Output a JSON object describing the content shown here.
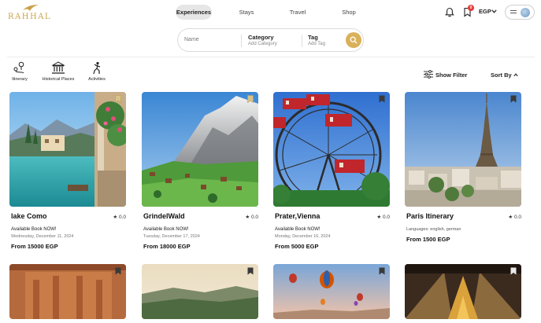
{
  "brand": {
    "name": "RAHHAL",
    "accent": "#c9a24a",
    "search_button": "#d9b15a"
  },
  "nav": {
    "experiences": "Experiences",
    "stays": "Stays",
    "travel": "Travel",
    "shop": "Shop"
  },
  "header": {
    "notification_count": "0",
    "currency": "EGP"
  },
  "search": {
    "name_placeholder": "Name",
    "category_label": "Category",
    "category_placeholder": "Add Category",
    "tag_label": "Tag",
    "tag_placeholder": "Add Tag"
  },
  "categories": [
    {
      "label": "Itinerary",
      "icon": "pin-route-icon"
    },
    {
      "label": "Historical Places",
      "icon": "museum-icon"
    },
    {
      "label": "Activities",
      "icon": "person-activity-icon"
    }
  ],
  "toolbar": {
    "filter_label": "Show Filter",
    "sort_label": "Sort By"
  },
  "cards": [
    {
      "title": "lake Como",
      "rating": "0.0",
      "availability": "Available Book NOW!",
      "date": "Wednesday, December 11, 2024",
      "price": "From 15000 EGP"
    },
    {
      "title": "GrindelWald",
      "rating": "0.0",
      "availability": "Available Book NOW!",
      "date": "Tuesday, December 17, 2024",
      "price": "From 18000 EGP"
    },
    {
      "title": "Prater,Vienna",
      "rating": "0.0",
      "availability": "Available Book NOW!",
      "date": "Monday, December 16, 2024",
      "price": "From 5000 EGP"
    },
    {
      "title": "Paris Itinerary",
      "rating": "0.0",
      "languages": "Languages: english, german",
      "price": "From 1500 EGP"
    }
  ]
}
